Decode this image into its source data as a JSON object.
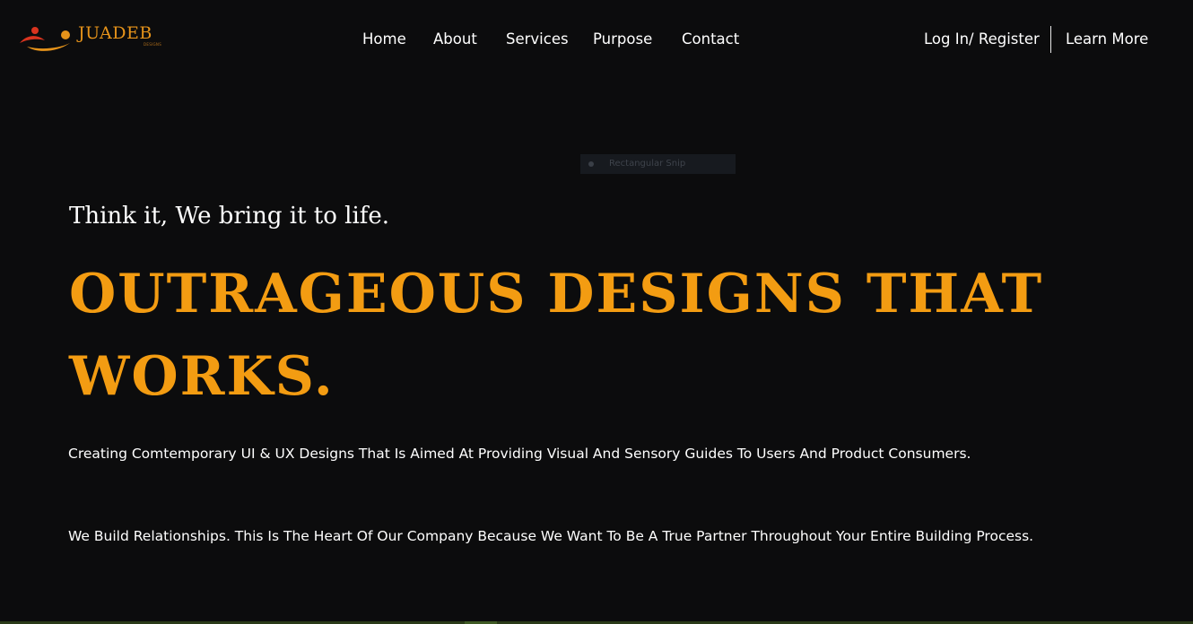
{
  "header": {
    "logo": {
      "wordmark": "JUADEB",
      "subtext": "DESIGNS"
    },
    "nav": {
      "home": "Home",
      "about": "About",
      "services": "Services",
      "purpose": "Purpose",
      "contact": "Contact"
    },
    "login_register": "Log In/ Register",
    "learn_more": "Learn More"
  },
  "overlay": {
    "snip_label": "Rectangular Snip"
  },
  "hero": {
    "tagline": "Think it, We bring it to life.",
    "headline": "OUTRAGEOUS DESIGNS THAT WORKS.",
    "description_1": "Creating Comtemporary UI & UX Designs That Is Aimed At Providing Visual And Sensory Guides To Users And Product Consumers.",
    "description_2": "We Build Relationships. This Is The Heart Of Our Company Because We Want To Be A True Partner Throughout Your Entire Building Process."
  },
  "colors": {
    "background": "#0c0c0d",
    "accent": "#f39c12",
    "logo_orange": "#e6931a",
    "logo_red": "#d9341f",
    "text": "#ffffff"
  }
}
